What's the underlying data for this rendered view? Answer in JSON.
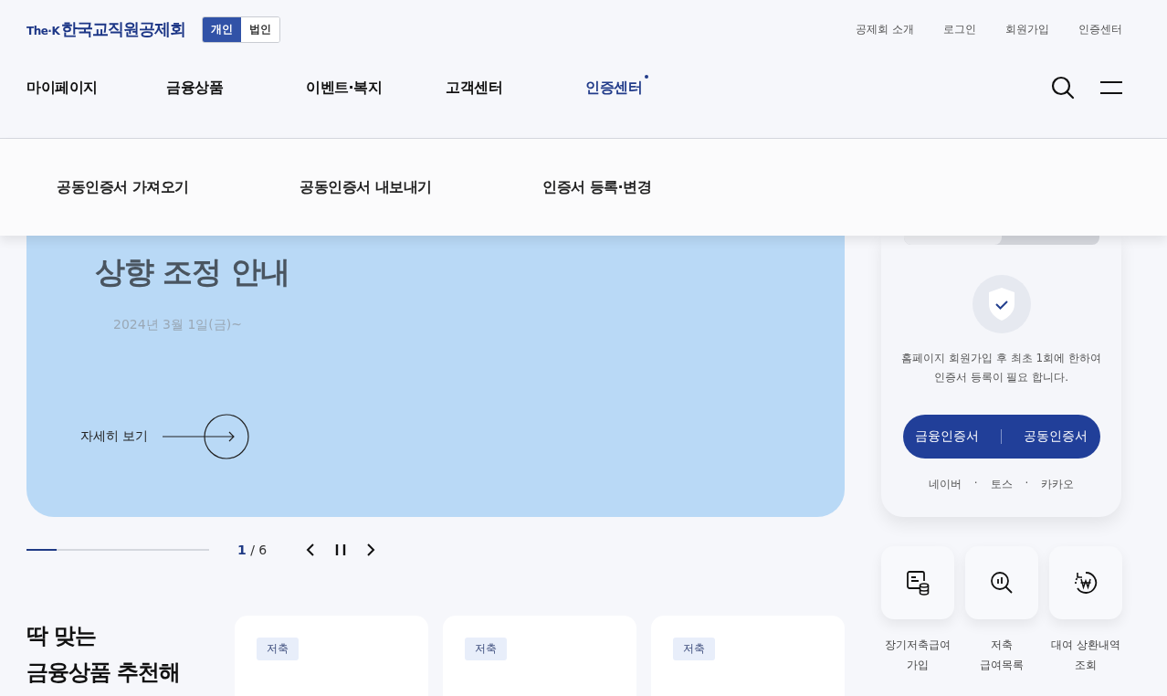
{
  "header": {
    "logo": {
      "prefix": "The·K",
      "name": "한국교직원공제회"
    },
    "member_types": [
      {
        "label": "개인",
        "selected": true
      },
      {
        "label": "법인",
        "selected": false
      }
    ],
    "utility_links": [
      "공제회 소개",
      "로그인",
      "회원가입",
      "인증센터"
    ],
    "nav": [
      {
        "label": "마이페이지",
        "selected": false
      },
      {
        "label": "금융상품",
        "selected": false
      },
      {
        "label": "이벤트·복지",
        "selected": false
      },
      {
        "label": "고객센터",
        "selected": false
      },
      {
        "label": "인증센터",
        "selected": true
      }
    ]
  },
  "submenu": [
    "공동인증서 가져오기",
    "공동인증서 내보내기",
    "인증서 등록·변경"
  ],
  "banner": {
    "title": "상향 조정 안내",
    "date": "2024년 3월 1일(금)~",
    "more": "자세히 보기"
  },
  "slider": {
    "level": 0.165,
    "current": "1",
    "total": "/ 6"
  },
  "cert_card": {
    "message": "홈페이지 회원가입 후 최초 1회에 한하여\n인증서 등록이 필요 합니다.",
    "buttons": [
      "금융인증서",
      "공동인증서"
    ],
    "links": [
      "네이버",
      "·",
      "토스",
      "·",
      "카카오"
    ]
  },
  "quick_menu": [
    {
      "kind": "document",
      "label": "장기저축급여\n가입"
    },
    {
      "kind": "search",
      "label": "저축\n급여목록"
    },
    {
      "kind": "refund",
      "label": "대여 상환내역\n조회"
    }
  ],
  "recommend": {
    "heading": "딱 맞는\n금융상품 추천해",
    "cards": [
      {
        "tag": "저축"
      },
      {
        "tag": "저축"
      },
      {
        "tag": "저축"
      }
    ]
  }
}
